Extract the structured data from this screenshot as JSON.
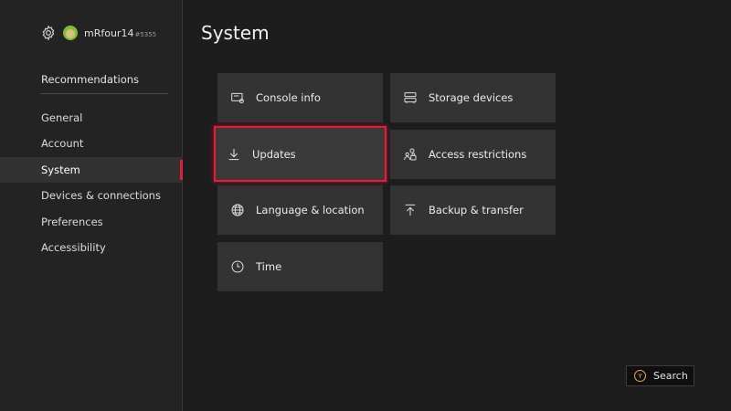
{
  "profile": {
    "gamertag": "mRfour14",
    "gamertag_suffix": "#5355",
    "settings_icon": "gear-icon",
    "avatar_color": "#7bbf3a"
  },
  "sidebar": {
    "top_item": "Recommendations",
    "items": [
      {
        "label": "General"
      },
      {
        "label": "Account"
      },
      {
        "label": "System",
        "selected": true
      },
      {
        "label": "Devices & connections"
      },
      {
        "label": "Preferences"
      },
      {
        "label": "Accessibility"
      }
    ],
    "accent_color": "#d8243a"
  },
  "page": {
    "title": "System"
  },
  "tiles": [
    {
      "label": "Console info",
      "icon": "console-info-icon"
    },
    {
      "label": "Storage devices",
      "icon": "storage-icon"
    },
    {
      "label": "Updates",
      "icon": "download-icon",
      "focused": true
    },
    {
      "label": "Access restrictions",
      "icon": "access-restrictions-icon"
    },
    {
      "label": "Language & location",
      "icon": "globe-icon"
    },
    {
      "label": "Backup & transfer",
      "icon": "upload-icon"
    },
    {
      "label": "Time",
      "icon": "clock-icon"
    }
  ],
  "search": {
    "button_glyph": "Y",
    "label": "Search",
    "glyph_color": "#e0b34a"
  }
}
